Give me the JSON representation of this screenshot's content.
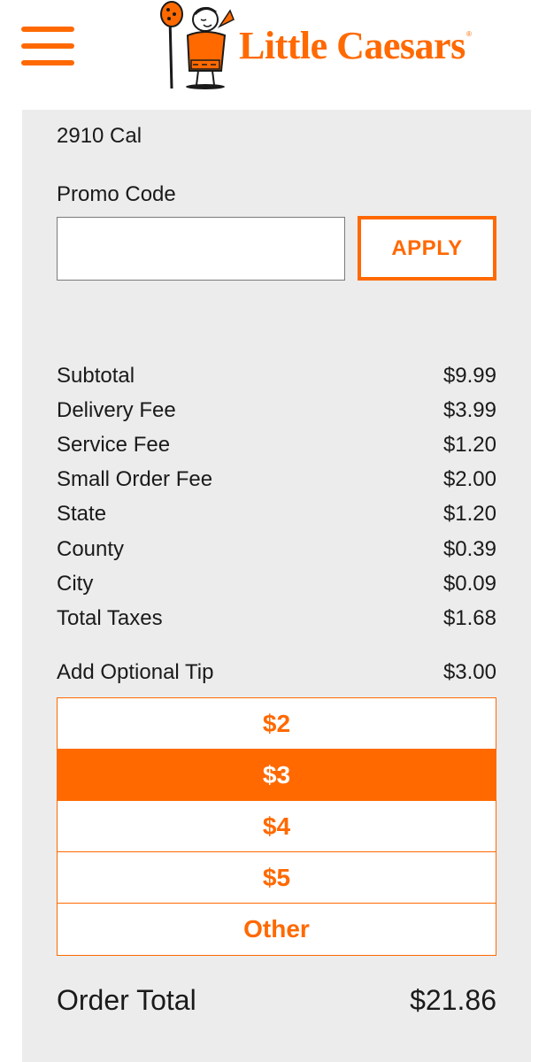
{
  "header": {
    "brand": "Little Caesars",
    "trademark": "®",
    "logo_mascot_icon": "caesar-mascot-icon",
    "menu_icon": "hamburger-menu-icon"
  },
  "summary": {
    "calories": "2910 Cal"
  },
  "promo": {
    "label": "Promo Code",
    "value": "",
    "placeholder": "",
    "apply_label": "APPLY"
  },
  "fees": [
    {
      "label": "Subtotal",
      "amount": "$9.99"
    },
    {
      "label": "Delivery Fee",
      "amount": "$3.99"
    },
    {
      "label": "Service Fee",
      "amount": "$1.20"
    },
    {
      "label": "Small Order Fee",
      "amount": "$2.00"
    },
    {
      "label": "State",
      "amount": "$1.20"
    },
    {
      "label": "County",
      "amount": "$0.39"
    },
    {
      "label": "City",
      "amount": "$0.09"
    },
    {
      "label": "Total Taxes",
      "amount": "$1.68"
    }
  ],
  "tip": {
    "label": "Add Optional Tip",
    "amount": "$3.00",
    "options": [
      "$2",
      "$3",
      "$4",
      "$5",
      "Other"
    ],
    "selected": "$3"
  },
  "total": {
    "label": "Order Total",
    "amount": "$21.86"
  },
  "colors": {
    "accent": "#ff6900",
    "panel_bg": "#ececec"
  }
}
